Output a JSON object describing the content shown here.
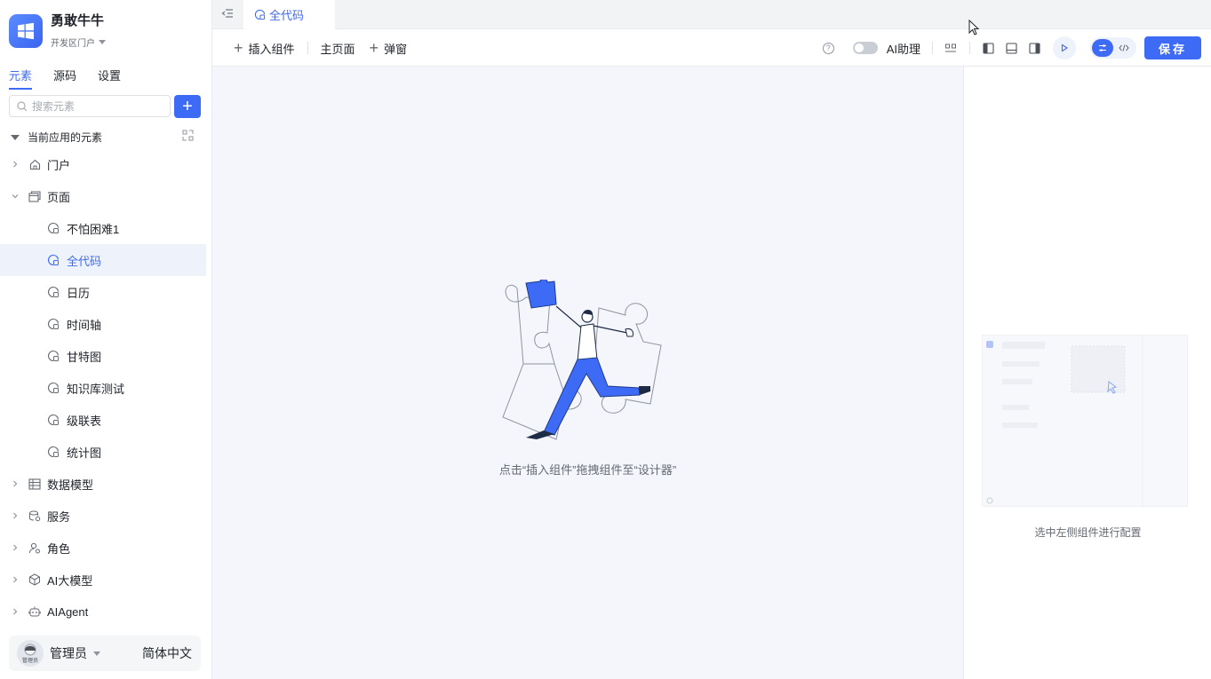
{
  "app": {
    "name": "勇敢牛牛",
    "portal": "开发区门户"
  },
  "sidebar": {
    "tabs": [
      {
        "label": "元素",
        "active": true
      },
      {
        "label": "源码",
        "active": false
      },
      {
        "label": "设置",
        "active": false
      }
    ],
    "search": {
      "placeholder": "搜索元素",
      "value": ""
    },
    "add_label": "+",
    "tree_header": "当前应用的元素",
    "tree": [
      {
        "label": "门户",
        "icon": "home-icon",
        "expanded": false
      },
      {
        "label": "页面",
        "icon": "pages-icon",
        "expanded": true
      },
      {
        "label": "不怕困难1",
        "icon": "code-page-icon",
        "child": true
      },
      {
        "label": "全代码",
        "icon": "code-page-icon",
        "child": true,
        "selected": true
      },
      {
        "label": "日历",
        "icon": "code-page-icon",
        "child": true
      },
      {
        "label": "时间轴",
        "icon": "code-page-icon",
        "child": true
      },
      {
        "label": "甘特图",
        "icon": "code-page-icon",
        "child": true
      },
      {
        "label": "知识库测试",
        "icon": "code-page-icon",
        "child": true
      },
      {
        "label": "级联表",
        "icon": "code-page-icon",
        "child": true
      },
      {
        "label": "统计图",
        "icon": "code-page-icon",
        "child": true
      },
      {
        "label": "数据模型",
        "icon": "table-icon",
        "expanded": false
      },
      {
        "label": "服务",
        "icon": "service-icon",
        "expanded": false
      },
      {
        "label": "角色",
        "icon": "role-icon",
        "expanded": false
      },
      {
        "label": "AI大模型",
        "icon": "cube-icon",
        "expanded": false
      },
      {
        "label": "AIAgent",
        "icon": "robot-icon",
        "expanded": false
      }
    ],
    "user": {
      "name": "管理员",
      "avatar_text": "管理员",
      "language": "简体中文"
    }
  },
  "tabs": [
    {
      "label": "全代码",
      "active": true
    }
  ],
  "toolbar": {
    "insert_label": "插入组件",
    "main_page_label": "主页面",
    "popup_label": "弹窗",
    "ai_label": "AI助理",
    "ai_enabled": false,
    "save_label": "保存"
  },
  "canvas": {
    "empty_hint": "点击“插入组件”拖拽组件至“设计器”"
  },
  "right_panel": {
    "hint": "选中左侧组件进行配置"
  },
  "colors": {
    "accent": "#3e6bf6",
    "selected_bg": "#eef2fb",
    "canvas_bg": "#f4f6fb"
  }
}
